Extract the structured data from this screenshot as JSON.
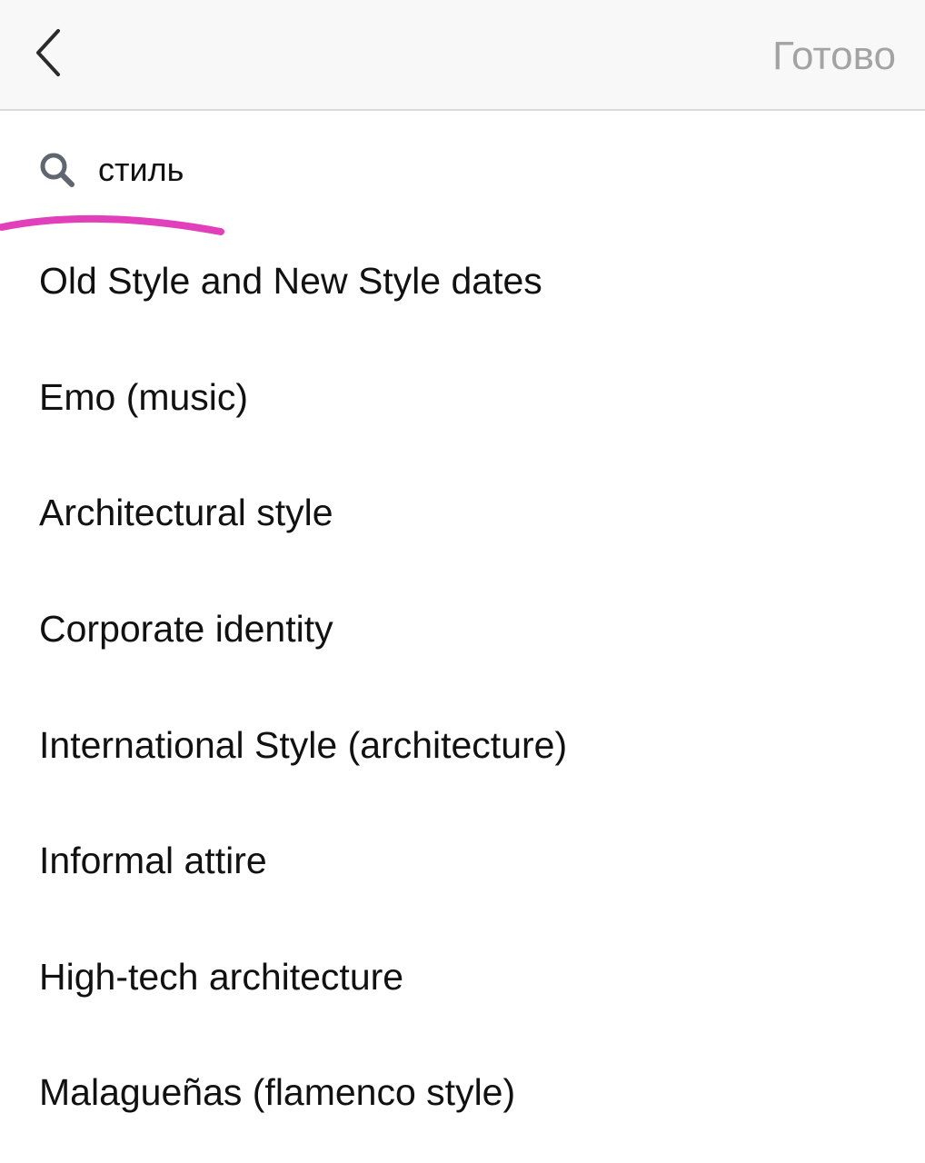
{
  "header": {
    "back_icon": "chevron-left-icon",
    "done_label": "Готово",
    "done_color": "#a3a3a3"
  },
  "search": {
    "icon": "search-icon",
    "value": "стиль"
  },
  "results": [
    "Old Style and New Style dates",
    "Emo (music)",
    "Architectural style",
    "Corporate identity",
    "International Style (architecture)",
    "Informal attire",
    "High-tech architecture",
    "Malagueñas (flamenco style)"
  ]
}
